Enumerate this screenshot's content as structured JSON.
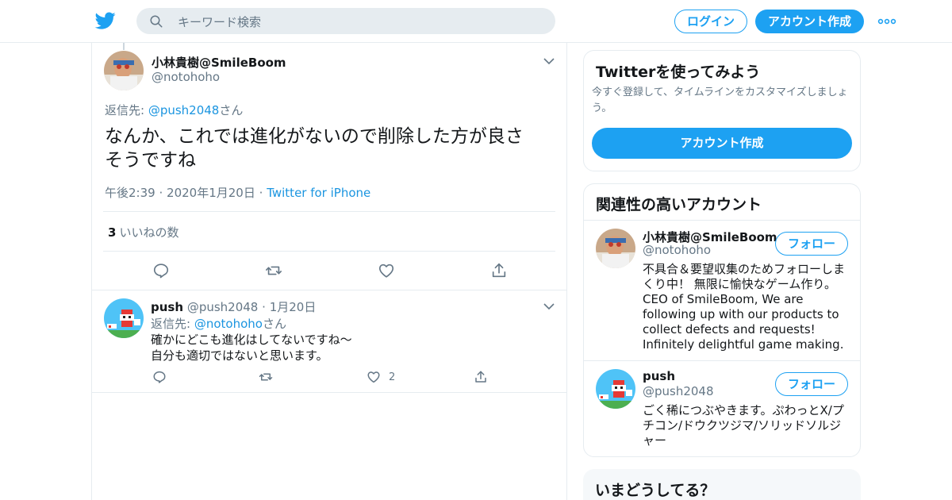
{
  "header": {
    "search_placeholder": "キーワード検索",
    "login_label": "ログイン",
    "signup_label": "アカウント作成",
    "more_icon": "more-dots-icon",
    "brand_color": "#1da1f2"
  },
  "main_tweet": {
    "name": "小林貴樹@SmileBoom",
    "handle": "@notohoho",
    "reply_prefix": "返信先: ",
    "reply_to": "@push2048",
    "reply_suffix": "さん",
    "text_line1": "なんか、これでは進化がないので削除した方が良さ",
    "text_line2": "そうですね",
    "time": "午後2:39",
    "dot": "·",
    "date": "2020年1月20日",
    "source": "Twitter for iPhone",
    "like_count": "3",
    "like_label": "いいねの数"
  },
  "reply_tweet": {
    "name": "push",
    "handle": "@push2048",
    "dot": "·",
    "date": "1月20日",
    "reply_prefix": "返信先: ",
    "reply_to": "@notohoho",
    "reply_suffix": "さん",
    "text_line1": "確かにどこも進化はしてないですね〜",
    "text_line2": "自分も適切ではないと思います。",
    "like_count": "2"
  },
  "sidebar": {
    "signup_card": {
      "title": "Twitterを使ってみよう",
      "desc": "今すぐ登録して、タイムラインをカスタマイズしましょう。",
      "button": "アカウント作成"
    },
    "related": {
      "title": "関連性の高いアカウント",
      "accounts": [
        {
          "name": "小林貴樹@SmileBoom",
          "handle": "@notohoho",
          "follow": "フォロー",
          "bio": "不具合＆要望収集のためフォローしまくり中！ 無限に愉快なゲーム作り。CEO of SmileBoom, We are following up with our products to collect defects and requests! Infinitely delightful game making."
        },
        {
          "name": "push",
          "handle": "@push2048",
          "follow": "フォロー",
          "bio": "ごく稀につぶやきます。ぷわっとX/プチコン/ドウクツジマ/ソリッドソルジャー"
        }
      ]
    },
    "trends_title": "いまどうしてる？"
  }
}
